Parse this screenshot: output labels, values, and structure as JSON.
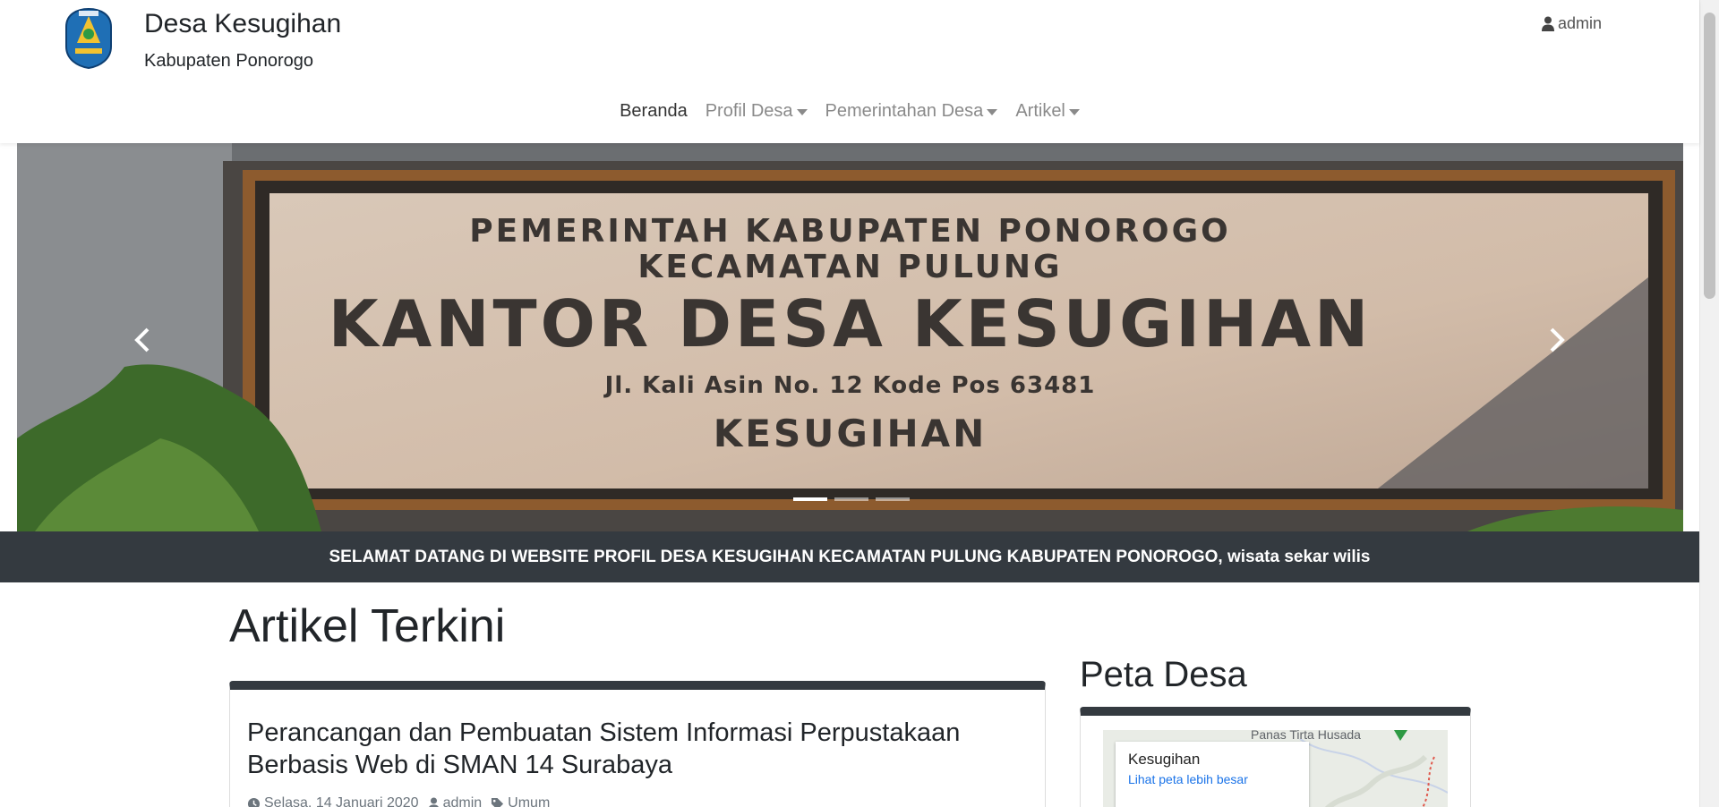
{
  "site": {
    "title": "Desa Kesugihan",
    "subtitle": "Kabupaten Ponorogo"
  },
  "user": {
    "icon": "user-icon",
    "name": "admin"
  },
  "nav": {
    "items": [
      {
        "label": "Beranda",
        "active": true,
        "dropdown": false
      },
      {
        "label": "Profil Desa",
        "active": false,
        "dropdown": true
      },
      {
        "label": "Pemerintahan Desa",
        "active": false,
        "dropdown": true
      },
      {
        "label": "Artikel",
        "active": false,
        "dropdown": true
      }
    ]
  },
  "carousel": {
    "sign": {
      "line1": "PEMERINTAH KABUPATEN PONOROGO",
      "line2": "KECAMATAN PULUNG",
      "line3": "KANTOR DESA KESUGIHAN",
      "line4": "Jl. Kali Asin No. 12 Kode Pos 63481",
      "line5": "KESUGIHAN"
    },
    "slide_count": 3,
    "active_slide": 1
  },
  "welcome": "SELAMAT DATANG DI WEBSITE PROFIL DESA KESUGIHAN KECAMATAN PULUNG KABUPATEN PONOROGO, wisata sekar wilis",
  "articles": {
    "heading": "Artikel Terkini",
    "items": [
      {
        "title": "Perancangan dan Pembuatan Sistem Informasi Perpustakaan Berbasis Web di SMAN 14 Surabaya",
        "date": "Selasa, 14 Januari 2020",
        "author": "admin",
        "category": "Umum"
      }
    ]
  },
  "sidebar": {
    "map_heading": "Peta Desa",
    "map": {
      "place": "Kesugihan",
      "link": "Lihat peta lebih besar",
      "label": "Panas Tirta Husada"
    }
  },
  "colors": {
    "dark": "#343a40",
    "link": "#1a73e8",
    "muted": "#6c757d"
  }
}
